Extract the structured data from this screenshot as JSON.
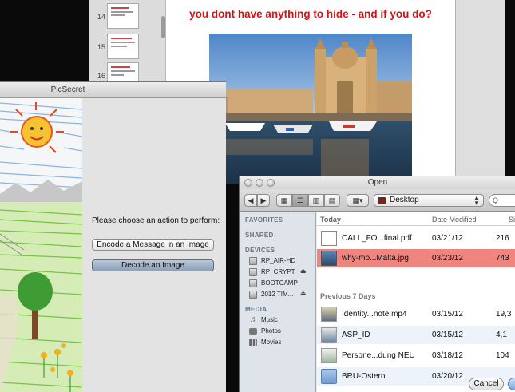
{
  "document_window": {
    "thumbnails": [
      {
        "number": "14"
      },
      {
        "number": "15"
      },
      {
        "number": "16"
      }
    ],
    "heading": "you dont have anything to hide - and if you do?"
  },
  "picsecret": {
    "title": "PicSecret",
    "prompt": "Please choose an action to perform:",
    "encode_label": "Encode a Message in an Image",
    "decode_label": "Decode an Image"
  },
  "open_dialog": {
    "title": "Open",
    "location": "Desktop",
    "search_placeholder": "Q",
    "sidebar": {
      "favorites_header": "FAVORITES",
      "shared_header": "SHARED",
      "devices_header": "DEVICES",
      "devices": [
        {
          "label": "RP_AIR-HD",
          "eject": ""
        },
        {
          "label": "RP_CRYPT",
          "eject": "⏏"
        },
        {
          "label": "BOOTCAMP",
          "eject": ""
        },
        {
          "label": "2012 TIM...",
          "eject": "⏏"
        }
      ],
      "media_header": "MEDIA",
      "media": [
        {
          "label": "Music",
          "icon": "music-icon"
        },
        {
          "label": "Photos",
          "icon": "camera-icon"
        },
        {
          "label": "Movies",
          "icon": "film-icon"
        }
      ]
    },
    "columns": {
      "name": "Today",
      "date": "Date Modified",
      "size": "Si"
    },
    "group_today": "Today",
    "group_prev7": "Previous 7 Days",
    "files_today": [
      {
        "name": "CALL_FO...final.pdf",
        "date": "03/21/12",
        "size": "216",
        "icon": "pdf-file-icon"
      },
      {
        "name": "why-mo...Malta.jpg",
        "date": "03/23/12",
        "size": "743",
        "icon": "image-file-icon"
      }
    ],
    "files_prev7": [
      {
        "name": "Identity...note.mp4",
        "date": "03/15/12",
        "size": "19,3",
        "icon": "video-file-icon"
      },
      {
        "name": "ASP_ID",
        "date": "03/15/12",
        "size": "4,1",
        "icon": "document-file-icon"
      },
      {
        "name": "Persone...dung NEU",
        "date": "03/18/12",
        "size": "104",
        "icon": "keynote-file-icon"
      },
      {
        "name": "BRU-Ostern",
        "date": "03/20/12",
        "size": "",
        "icon": "folder-icon"
      }
    ],
    "cancel_label": "Cancel"
  }
}
